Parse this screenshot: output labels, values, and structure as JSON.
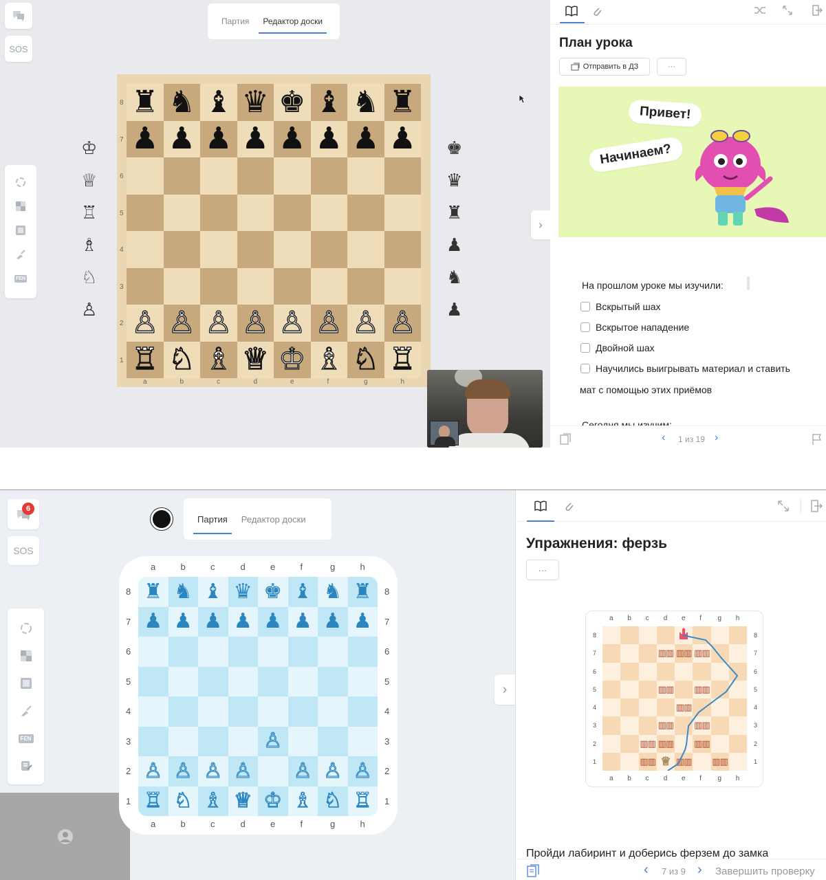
{
  "top": {
    "tabs": [
      "Партия",
      "Редактор доски"
    ],
    "active_tab": 1,
    "sos_label": "SOS",
    "fen_label": "FEN",
    "board": {
      "ranks": [
        "8",
        "7",
        "6",
        "5",
        "4",
        "3",
        "2",
        "1"
      ],
      "files": [
        "a",
        "b",
        "c",
        "d",
        "e",
        "f",
        "g",
        "h"
      ],
      "position": [
        [
          "♜",
          "♞",
          "♝",
          "♛",
          "♚",
          "♝",
          "♞",
          "♜"
        ],
        [
          "♟",
          "♟",
          "♟",
          "♟",
          "♟",
          "♟",
          "♟",
          "♟"
        ],
        [
          "",
          "",
          "",
          "",
          "",
          "",
          "",
          ""
        ],
        [
          "",
          "",
          "",
          "",
          "",
          "",
          "",
          ""
        ],
        [
          "",
          "",
          "",
          "",
          "",
          "",
          "",
          ""
        ],
        [
          "",
          "",
          "",
          "",
          "",
          "",
          "",
          ""
        ],
        [
          "♙",
          "♙",
          "♙",
          "♙",
          "♙",
          "♙",
          "♙",
          "♙"
        ],
        [
          "♖",
          "♘",
          "♗",
          "♕",
          "♔",
          "♗",
          "♘",
          "♖"
        ]
      ]
    },
    "reserve_white": [
      "♔",
      "♕",
      "♖",
      "♗",
      "♘",
      "♙"
    ],
    "reserve_black": [
      "♚",
      "♛",
      "♜",
      "♟",
      "♞",
      "♟"
    ],
    "lesson": {
      "title": "План урока",
      "send_hw": "Отправить в ДЗ",
      "more": "···",
      "bubble1": "Привет!",
      "bubble2": "Начинаем?",
      "intro": "На прошлом уроке мы изучили:",
      "items": [
        "Вскрытый шах",
        "Вскрытое нападение",
        "Двойной шах",
        "Научились выигрывать материал и ставить"
      ],
      "item_continued": "мат с помощью этих приёмов",
      "cut_text": "Сегодня мы изучим:",
      "pager": "1 из 19"
    }
  },
  "bottom": {
    "tabs": [
      "Партия",
      "Редактор доски"
    ],
    "active_tab": 0,
    "chat_badge": "6",
    "sos_label": "SOS",
    "fen_label": "FEN",
    "board": {
      "ranks": [
        "8",
        "7",
        "6",
        "5",
        "4",
        "3",
        "2",
        "1"
      ],
      "files": [
        "a",
        "b",
        "c",
        "d",
        "e",
        "f",
        "g",
        "h"
      ],
      "position": [
        [
          "♜",
          "♞",
          "♝",
          "♛",
          "♚",
          "♝",
          "♞",
          "♜"
        ],
        [
          "♟",
          "♟",
          "♟",
          "♟",
          "♟",
          "♟",
          "♟",
          "♟"
        ],
        [
          "",
          "",
          "",
          "",
          "",
          "",
          "",
          ""
        ],
        [
          "",
          "",
          "",
          "",
          "",
          "",
          "",
          ""
        ],
        [
          "",
          "",
          "",
          "",
          "",
          "",
          "",
          ""
        ],
        [
          "",
          "",
          "",
          "",
          "♙",
          "",
          "",
          ""
        ],
        [
          "♙",
          "♙",
          "♙",
          "♙",
          "",
          "♙",
          "♙",
          "♙"
        ],
        [
          "♖",
          "♘",
          "♗",
          "♕",
          "♔",
          "♗",
          "♘",
          "♖"
        ]
      ]
    },
    "exercise": {
      "title": "Упражнения: ферзь",
      "more": "···",
      "task": "Пройди лабиринт и доберись ферзем до замка",
      "pager": "7 из 9",
      "finish": "Завершить проверку",
      "maze_files": [
        "a",
        "b",
        "c",
        "d",
        "e",
        "f",
        "g",
        "h"
      ],
      "maze_ranks": [
        "8",
        "7",
        "6",
        "5",
        "4",
        "3",
        "2",
        "1"
      ],
      "castle": "e8",
      "queen": "d1",
      "fences": [
        "d7",
        "e7",
        "f7",
        "d5",
        "f5",
        "e4",
        "d3",
        "f3",
        "c2",
        "d2",
        "f2",
        "c1",
        "e1",
        "g1"
      ]
    }
  },
  "colors": {
    "accent": "#4a7fd6",
    "board_light": "#efdcb8",
    "board_dark": "#c8a97e",
    "blue_light": "#e4f6fc",
    "blue_dark": "#bfe7f6",
    "blue_piece": "#2b86bf",
    "lesson_bg": "#e7f7b5",
    "badge": "#e53935"
  }
}
